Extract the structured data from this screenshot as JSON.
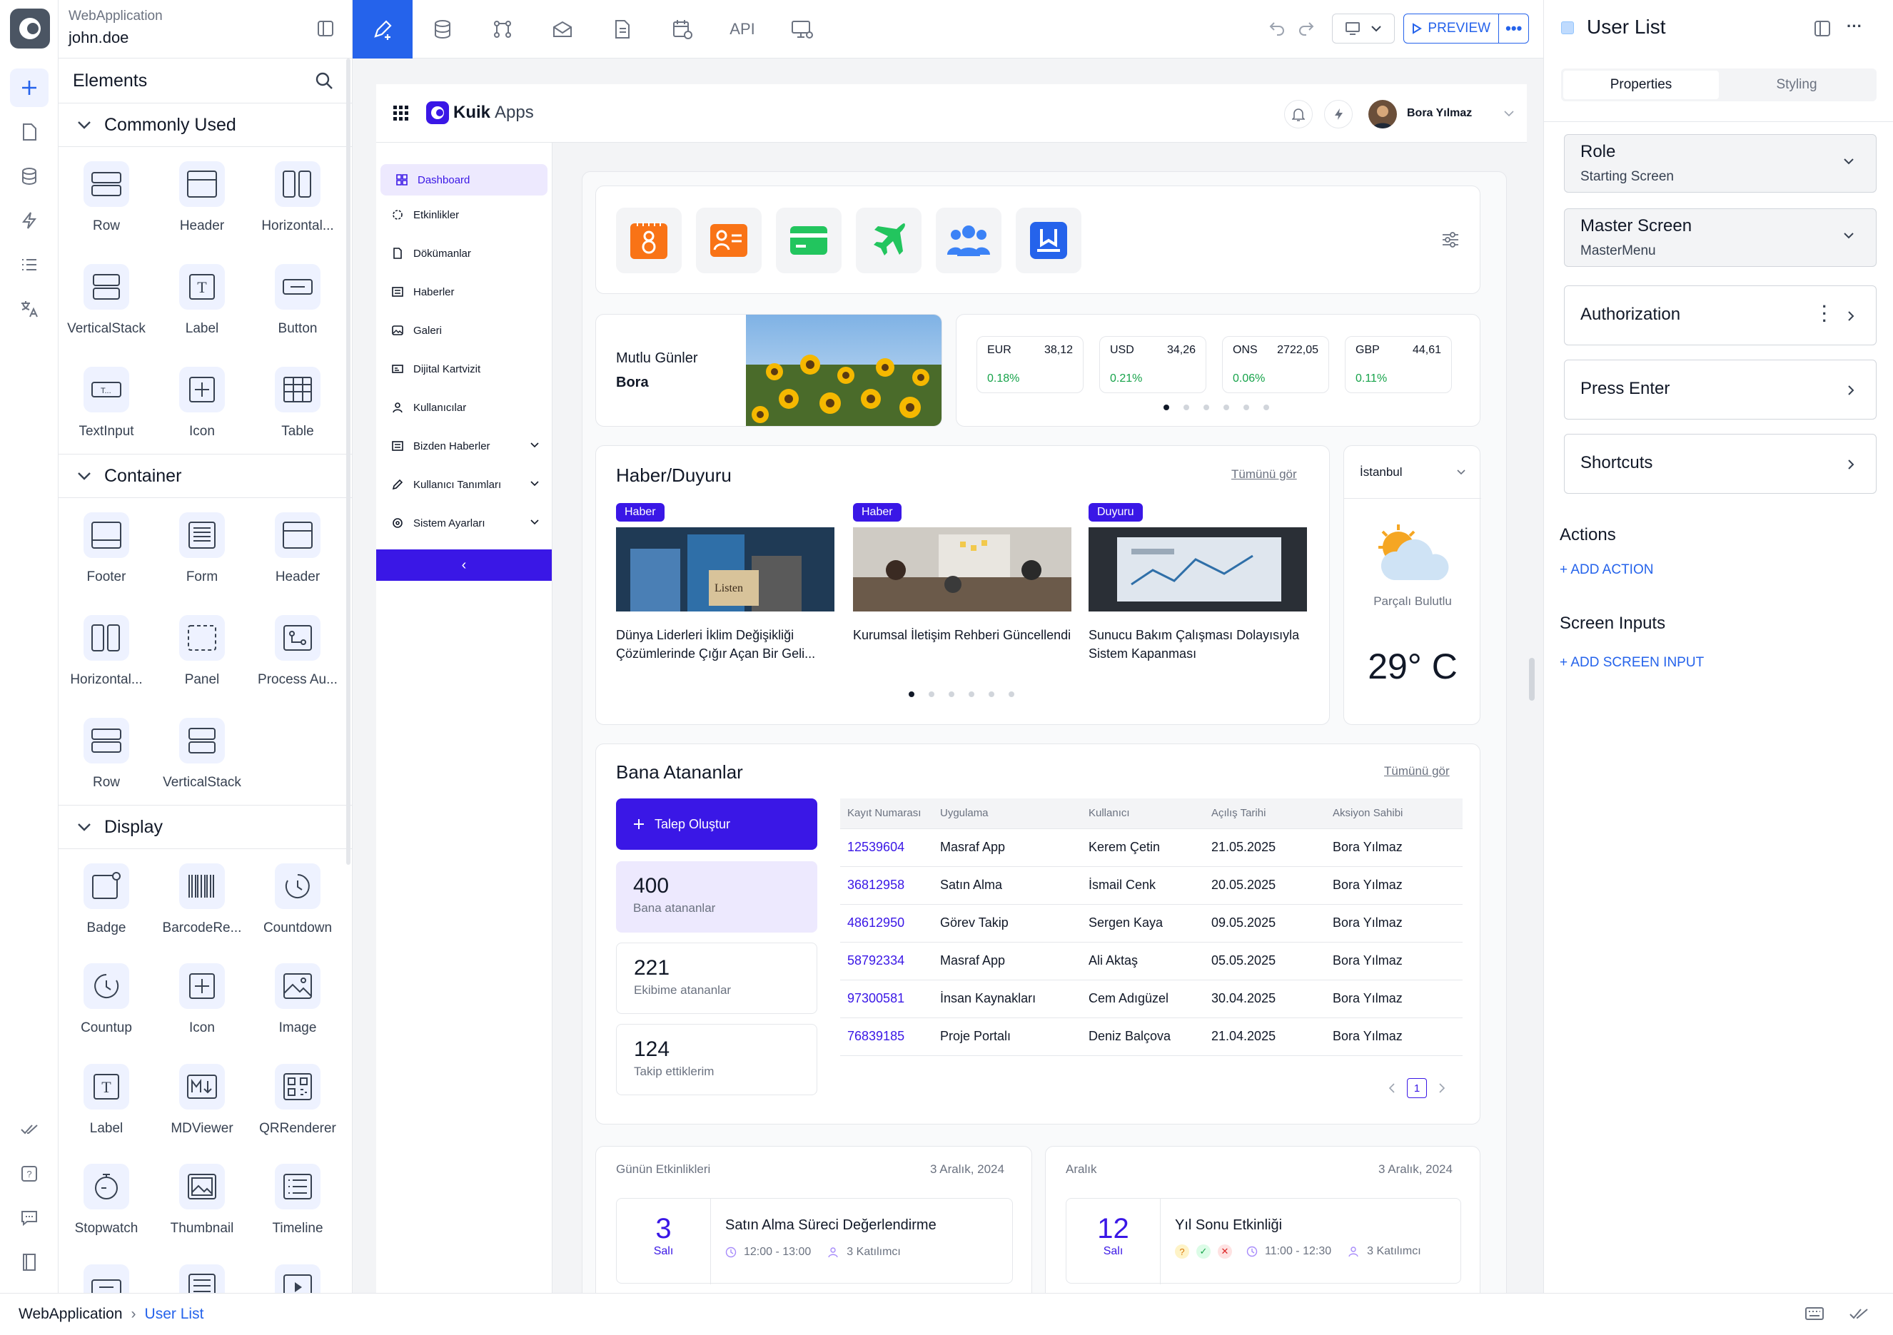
{
  "workspace": {
    "app": "WebApplication",
    "user": "john.doe"
  },
  "elements": {
    "title": "Elements",
    "sections": [
      {
        "title": "Commonly Used",
        "items": [
          "Row",
          "Header",
          "Horizontal...",
          "VerticalStack",
          "Label",
          "Button",
          "TextInput",
          "Icon",
          "Table"
        ]
      },
      {
        "title": "Container",
        "items": [
          "Footer",
          "Form",
          "Header",
          "Horizontal...",
          "Panel",
          "Process Au...",
          "Row",
          "VerticalStack"
        ]
      },
      {
        "title": "Display",
        "items": [
          "Badge",
          "BarcodeRe...",
          "Countdown",
          "Countup",
          "Icon",
          "Image",
          "Label",
          "MDViewer",
          "QRRenderer",
          "Stopwatch",
          "Thumbnail",
          "Timeline"
        ]
      }
    ]
  },
  "toolbar": {
    "api": "API",
    "preview": "PREVIEW"
  },
  "device": {
    "brand": "Kuik",
    "brand2": "Apps",
    "username": "Bora Yılmaz",
    "nav": [
      "Dashboard",
      "Etkinlikler",
      "Dökümanlar",
      "Haberler",
      "Galeri",
      "Dijital Kartvizit",
      "Kullanıcılar",
      "Bizden Haberler",
      "Kullanıcı Tanımları",
      "Sistem Ayarları"
    ],
    "collapse": "‹",
    "greeting": {
      "line1": "Mutlu Günler",
      "line2": "Bora"
    },
    "currencies": [
      {
        "code": "EUR",
        "value": "38,12",
        "change": "0.18%"
      },
      {
        "code": "USD",
        "value": "34,26",
        "change": "0.21%"
      },
      {
        "code": "ONS",
        "value": "2722,05",
        "change": "0.06%"
      },
      {
        "code": "GBP",
        "value": "44,61",
        "change": "0.11%"
      }
    ],
    "news": {
      "title": "Haber/Duyuru",
      "see_all": "Tümünü gör",
      "items": [
        {
          "tag": "Haber",
          "text": "Dünya Liderleri İklim Değişikliği Çözümlerinde Çığır Açan Bir Geli..."
        },
        {
          "tag": "Haber",
          "text": "Kurumsal İletişim Rehberi Güncellendi"
        },
        {
          "tag": "Duyuru",
          "text": "Sunucu Bakım Çalışması Dolayısıyla Sistem Kapanması"
        }
      ]
    },
    "weather": {
      "city": "İstanbul",
      "desc": "Parçalı Bulutlu",
      "temp": "29° C"
    },
    "assigned": {
      "title": "Bana Atananlar",
      "see_all": "Tümünü gör",
      "create": "Talep Oluştur",
      "stats": [
        {
          "num": "400",
          "label": "Bana atananlar"
        },
        {
          "num": "221",
          "label": "Ekibime atananlar"
        },
        {
          "num": "124",
          "label": "Takip ettiklerim"
        }
      ],
      "columns": [
        "Kayıt Numarası",
        "Uygulama",
        "Kullanıcı",
        "Açılış Tarihi",
        "Aksiyon Sahibi"
      ],
      "rows": [
        [
          "12539604",
          "Masraf App",
          "Kerem Çetin",
          "21.05.2025",
          "Bora Yılmaz"
        ],
        [
          "36812958",
          "Satın Alma",
          "İsmail Cenk",
          "20.05.2025",
          "Bora Yılmaz"
        ],
        [
          "48612950",
          "Görev Takip",
          "Sergen Kaya",
          "09.05.2025",
          "Bora Yılmaz"
        ],
        [
          "58792334",
          "Masraf App",
          "Ali Aktaş",
          "05.05.2025",
          "Bora Yılmaz"
        ],
        [
          "97300581",
          "İnsan Kaynakları",
          "Cem Adıgüzel",
          "30.04.2025",
          "Bora Yılmaz"
        ],
        [
          "76839185",
          "Proje Portalı",
          "Deniz Balçova",
          "21.04.2025",
          "Bora Yılmaz"
        ]
      ],
      "page": "1"
    },
    "events": [
      {
        "title": "Günün Etkinlikleri",
        "date": "3 Aralık, 2024",
        "day": "3",
        "dayname": "Salı",
        "event": "Satın Alma Süreci Değerlendirme",
        "time": "12:00 - 13:00",
        "count": "3 Katılımcı"
      },
      {
        "title": "Aralık",
        "date": "3 Aralık, 2024",
        "day": "12",
        "dayname": "Salı",
        "event": "Yıl Sonu Etkinliği",
        "time": "11:00 - 12:30",
        "count": "3 Katılımcı"
      }
    ]
  },
  "right": {
    "title": "User List",
    "tabs": [
      "Properties",
      "Styling"
    ],
    "role": {
      "label": "Role",
      "value": "Starting Screen"
    },
    "master": {
      "label": "Master Screen",
      "value": "MasterMenu"
    },
    "authorization": "Authorization",
    "press_enter": "Press Enter",
    "shortcuts": "Shortcuts",
    "actions": "Actions",
    "add_action": "+ ADD ACTION",
    "screen_inputs": "Screen Inputs",
    "add_input": "+ ADD SCREEN INPUT"
  },
  "breadcrumb": {
    "root": "WebApplication",
    "sep": "›",
    "current": "User List"
  },
  "colors": {
    "primary": "#3a17e6",
    "blue": "#2563eb",
    "green": "#16a34a"
  }
}
